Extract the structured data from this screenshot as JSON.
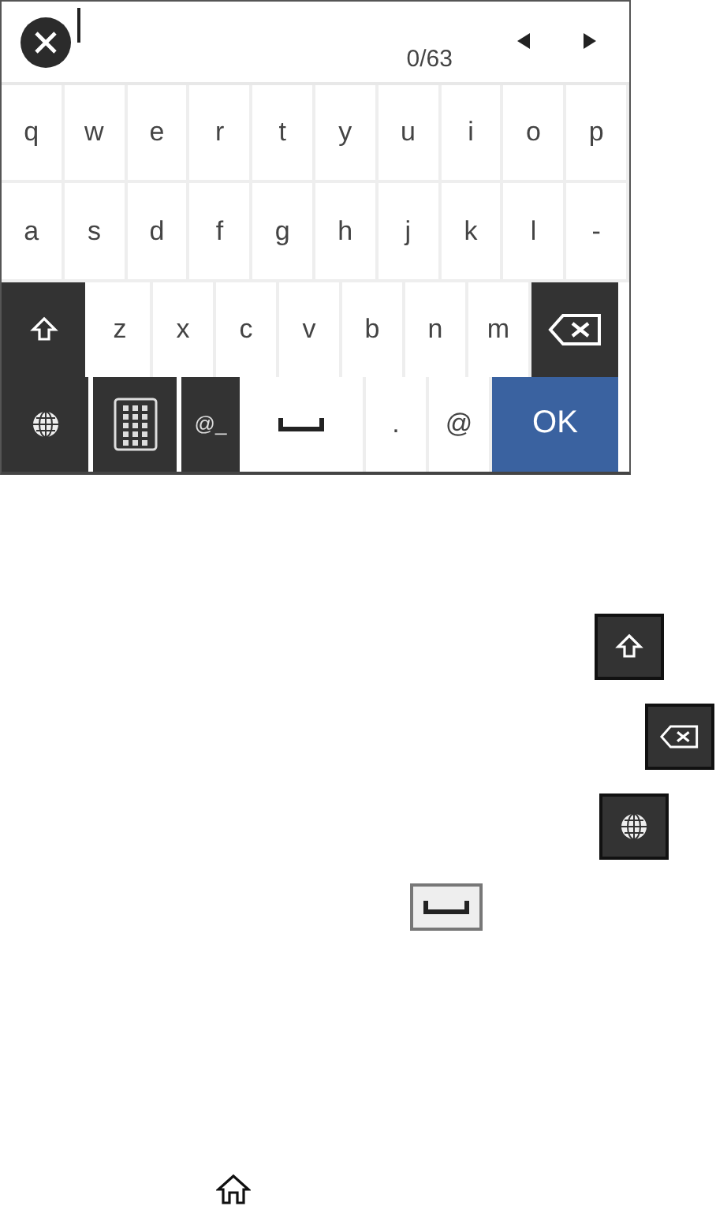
{
  "input": {
    "counter": "0/63",
    "cursor": true
  },
  "keyboard": {
    "letter_rows": [
      [
        {
          "kind": "char",
          "label": "q"
        },
        {
          "kind": "char",
          "label": "w"
        },
        {
          "kind": "char",
          "label": "e"
        },
        {
          "kind": "char",
          "label": "r"
        },
        {
          "kind": "char",
          "label": "t"
        },
        {
          "kind": "char",
          "label": "y"
        },
        {
          "kind": "char",
          "label": "u"
        },
        {
          "kind": "char",
          "label": "i"
        },
        {
          "kind": "char",
          "label": "o"
        },
        {
          "kind": "char",
          "label": "p"
        }
      ],
      [
        {
          "kind": "char",
          "label": "a"
        },
        {
          "kind": "char",
          "label": "s"
        },
        {
          "kind": "char",
          "label": "d"
        },
        {
          "kind": "char",
          "label": "f"
        },
        {
          "kind": "char",
          "label": "g"
        },
        {
          "kind": "char",
          "label": "h"
        },
        {
          "kind": "char",
          "label": "j"
        },
        {
          "kind": "char",
          "label": "k"
        },
        {
          "kind": "char",
          "label": "l"
        },
        {
          "kind": "char",
          "label": "-"
        }
      ],
      [
        {
          "kind": "shift"
        },
        {
          "kind": "char",
          "label": "z"
        },
        {
          "kind": "char",
          "label": "x"
        },
        {
          "kind": "char",
          "label": "c"
        },
        {
          "kind": "char",
          "label": "v"
        },
        {
          "kind": "char",
          "label": "b"
        },
        {
          "kind": "char",
          "label": "n"
        },
        {
          "kind": "char",
          "label": "m"
        },
        {
          "kind": "backspace"
        }
      ]
    ],
    "bottom_row": [
      {
        "kind": "globe"
      },
      {
        "kind": "keypad"
      },
      {
        "kind": "symbols",
        "label": "@_"
      },
      {
        "kind": "space"
      },
      {
        "kind": "char",
        "label": "."
      },
      {
        "kind": "char",
        "label": "@"
      },
      {
        "kind": "ok",
        "label": "OK"
      }
    ]
  },
  "legend_icons": [
    {
      "kind": "shift"
    },
    {
      "kind": "backspace"
    },
    {
      "kind": "globe"
    },
    {
      "kind": "space"
    }
  ],
  "footer_icon": {
    "kind": "home"
  }
}
